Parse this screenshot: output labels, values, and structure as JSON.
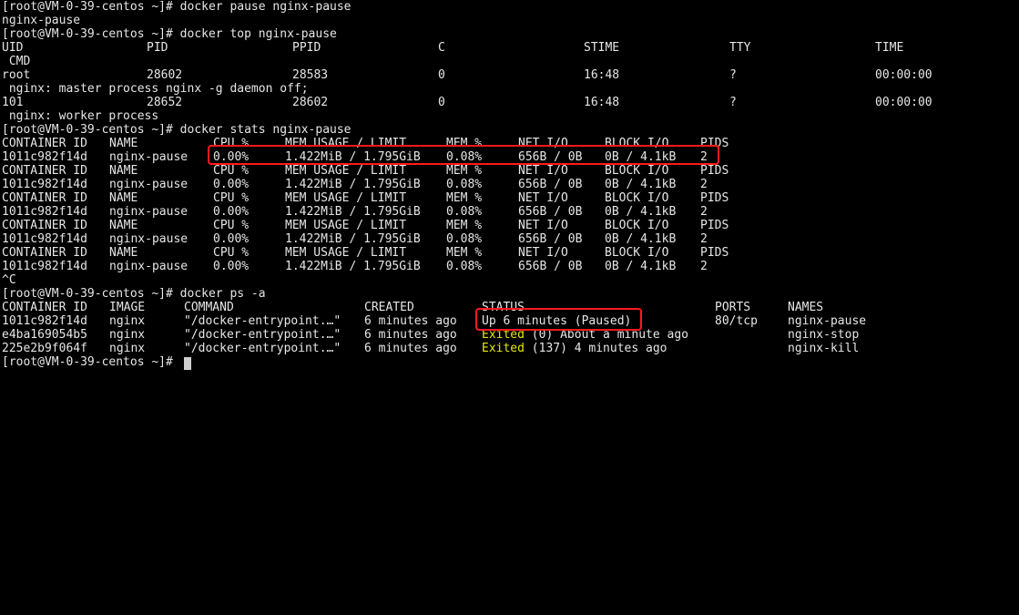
{
  "terminal": {
    "lines": {
      "l01": "[root@VM-0-39-centos ~]# docker pause nginx-pause",
      "l02": "nginx-pause",
      "l03": "[root@VM-0-39-centos ~]# docker top nginx-pause",
      "l04": [
        "UID",
        "PID",
        "PPID",
        "C",
        "STIME",
        "TTY",
        "TIME"
      ],
      "l05": " CMD",
      "l06": [
        "root",
        "28602",
        "28583",
        "0",
        "16:48",
        "?",
        "00:00:00"
      ],
      "l07": " nginx: master process nginx -g daemon off;",
      "l08": [
        "101",
        "28652",
        "28602",
        "0",
        "16:48",
        "?",
        "00:00:00"
      ],
      "l09": " nginx: worker process",
      "l10": "[root@VM-0-39-centos ~]# docker stats nginx-pause",
      "l11": [
        "CONTAINER ID",
        "NAME",
        "CPU %",
        "MEM USAGE / LIMIT",
        "MEM %",
        "NET I/O",
        "BLOCK I/O",
        "PIDS"
      ],
      "l12": [
        "1011c982f14d",
        "nginx-pause",
        "0.00%",
        "1.422MiB / 1.795GiB",
        "0.08%",
        "656B / 0B",
        "0B / 4.1kB",
        "2"
      ],
      "l13": [
        "CONTAINER ID",
        "NAME",
        "CPU %",
        "MEM USAGE / LIMIT",
        "MEM %",
        "NET I/O",
        "BLOCK I/O",
        "PIDS"
      ],
      "l14": [
        "1011c982f14d",
        "nginx-pause",
        "0.00%",
        "1.422MiB / 1.795GiB",
        "0.08%",
        "656B / 0B",
        "0B / 4.1kB",
        "2"
      ],
      "l15": [
        "CONTAINER ID",
        "NAME",
        "CPU %",
        "MEM USAGE / LIMIT",
        "MEM %",
        "NET I/O",
        "BLOCK I/O",
        "PIDS"
      ],
      "l16": [
        "1011c982f14d",
        "nginx-pause",
        "0.00%",
        "1.422MiB / 1.795GiB",
        "0.08%",
        "656B / 0B",
        "0B / 4.1kB",
        "2"
      ],
      "l17": [
        "CONTAINER ID",
        "NAME",
        "CPU %",
        "MEM USAGE / LIMIT",
        "MEM %",
        "NET I/O",
        "BLOCK I/O",
        "PIDS"
      ],
      "l18": [
        "1011c982f14d",
        "nginx-pause",
        "0.00%",
        "1.422MiB / 1.795GiB",
        "0.08%",
        "656B / 0B",
        "0B / 4.1kB",
        "2"
      ],
      "l19": [
        "CONTAINER ID",
        "NAME",
        "CPU %",
        "MEM USAGE / LIMIT",
        "MEM %",
        "NET I/O",
        "BLOCK I/O",
        "PIDS"
      ],
      "l20": [
        "1011c982f14d",
        "nginx-pause",
        "0.00%",
        "1.422MiB / 1.795GiB",
        "0.08%",
        "656B / 0B",
        "0B / 4.1kB",
        "2"
      ],
      "l21": "^C",
      "l22": "[root@VM-0-39-centos ~]# docker ps -a",
      "l23": [
        "CONTAINER ID",
        "IMAGE",
        "COMMAND",
        "CREATED",
        "STATUS",
        "PORTS",
        "NAMES"
      ],
      "l24": [
        "1011c982f14d",
        "nginx",
        "\"/docker-entrypoint.…\"",
        "6 minutes ago",
        "Up 6 minutes (Paused)",
        "80/tcp",
        "nginx-pause"
      ],
      "l25": [
        "e4ba169054b5",
        "nginx",
        "\"/docker-entrypoint.…\"",
        "6 minutes ago",
        "Exited",
        " (0) About a minute ago",
        "",
        "nginx-stop"
      ],
      "l26": [
        "225e2b9f064f",
        "nginx",
        "\"/docker-entrypoint.…\"",
        "6 minutes ago",
        "Exited",
        " (137) 4 minutes ago",
        "",
        "nginx-kill"
      ],
      "l27": "[root@VM-0-39-centos ~]# "
    },
    "colors": {
      "text": "#e6e6e6",
      "exited": "#e6e600",
      "highlight_box": "#ff1a1a",
      "background": "#000000"
    }
  }
}
